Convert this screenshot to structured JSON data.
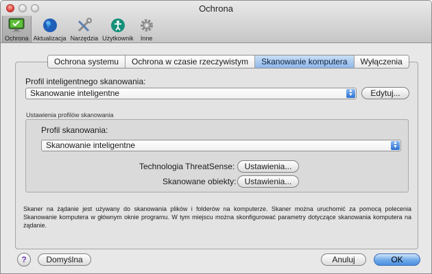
{
  "window": {
    "title": "Ochrona"
  },
  "toolbar": {
    "items": [
      {
        "label": "Ochrona",
        "icon": "monitor-check-icon",
        "selected": true
      },
      {
        "label": "Aktualizacja",
        "icon": "globe-icon"
      },
      {
        "label": "Narzędzia",
        "icon": "tools-icon"
      },
      {
        "label": "Użytkownik",
        "icon": "accessibility-user-icon"
      },
      {
        "label": "Inne",
        "icon": "gear-icon"
      }
    ]
  },
  "tabs": [
    {
      "label": "Ochrona systemu"
    },
    {
      "label": "Ochrona w czasie rzeczywistym"
    },
    {
      "label": "Skanowanie komputera",
      "active": true
    },
    {
      "label": "Wyłączenia"
    }
  ],
  "main": {
    "profile_label": "Profil inteligentnego skanowania:",
    "profile_value": "Skanowanie inteligentne",
    "edit_button": "Edytuj...",
    "group_title": "Ustawienia profilów skanowania",
    "scan_profile_label": "Profil skanowania:",
    "scan_profile_value": "Skanowanie inteligentne",
    "threatsense_label": "Technologia ThreatSense:",
    "threatsense_button": "Ustawienia...",
    "scanned_objects_label": "Skanowane obiekty:",
    "scanned_objects_button": "Ustawienia...",
    "description": "Skaner na żądanie jest używany do skanowania plików i folderów na komputerze. Skaner można uruchomić za pomocą polecenia Skanowanie komputera w głównym oknie programu. W tym miejscu można skonfigurować parametry dotyczące skanowania komputera na żądanie."
  },
  "footer": {
    "help": "?",
    "default_button": "Domyślna",
    "cancel_button": "Anuluj",
    "ok_button": "OK"
  },
  "colors": {
    "accent": "#4b8fe0",
    "tab_active": "#8fb7e8"
  }
}
